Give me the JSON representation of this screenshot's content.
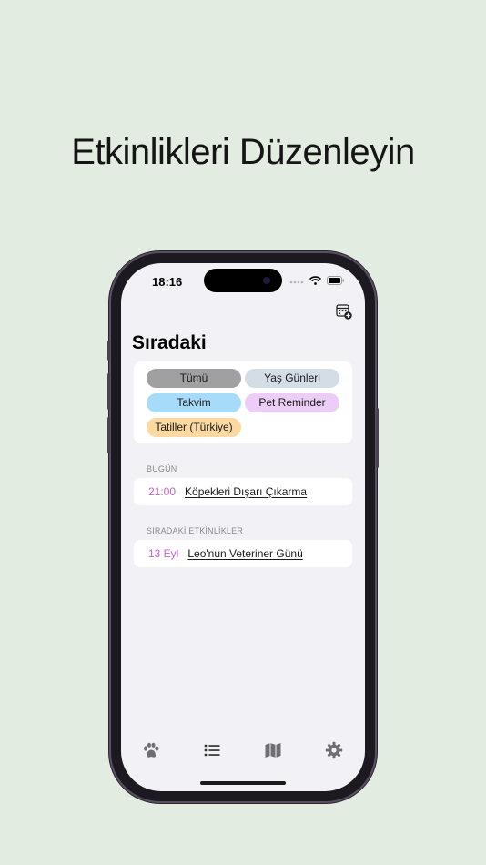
{
  "headline": "Etkinlikleri Düzenleyin",
  "status": {
    "time": "18:16"
  },
  "screen": {
    "title": "Sıradaki",
    "filters": [
      {
        "label": "Tümü",
        "color": "#a0a0a2"
      },
      {
        "label": "Yaş Günleri",
        "color": "#d4dce6"
      },
      {
        "label": "Takvim",
        "color": "#a6dbfa"
      },
      {
        "label": "Pet Reminder",
        "color": "#ebcdf5"
      },
      {
        "label": "Tatiller (Türkiye)",
        "color": "#fcd9a0"
      }
    ],
    "today": {
      "label": "BUGÜN",
      "events": [
        {
          "time": "21:00",
          "title": "Köpekleri Dışarı Çıkarma"
        }
      ]
    },
    "upcoming": {
      "label": "SIRADAKİ ETKİNLİKLER",
      "events": [
        {
          "time": "13 Eyl",
          "title": "Leo'nun Veteriner Günü"
        }
      ]
    }
  },
  "tabbar": {
    "items": [
      {
        "icon": "paw-icon"
      },
      {
        "icon": "list-icon"
      },
      {
        "icon": "map-icon"
      },
      {
        "icon": "gear-icon"
      }
    ]
  },
  "colors": {
    "background": "#e2ece1",
    "accent": "#c461c9",
    "tab_icon": "#6e6e73"
  }
}
